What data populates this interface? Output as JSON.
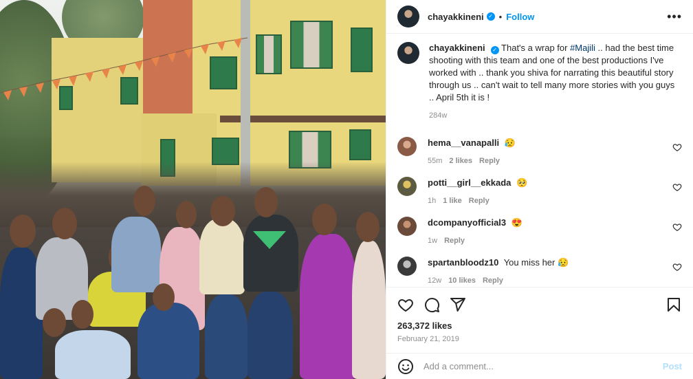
{
  "post": {
    "username": "chayakkineni",
    "follow_label": "Follow",
    "more_label": "•••",
    "verified_mark": "✓"
  },
  "caption": {
    "username": "chayakkineni",
    "text_before": "That's a wrap for ",
    "hashtag": "#Majili",
    "text_after": " .. had the best time shooting with this team and one of the best productions I've worked with .. thank you shiva for narrating this beautiful story through us .. can't wait to tell many more stories with you guys .. April 5th it is !",
    "age": "284w"
  },
  "comments": [
    {
      "username": "hema__vanapalli",
      "text": "😥",
      "age": "55m",
      "likes": "2 likes",
      "reply": "Reply",
      "avatar_color": "#8a5a44"
    },
    {
      "username": "potti__girl__ekkada",
      "text": "🥺",
      "age": "1h",
      "likes": "1 like",
      "reply": "Reply",
      "avatar_color": "#5c5a40"
    },
    {
      "username": "dcompanyofficial3",
      "text": "😍",
      "age": "1w",
      "likes": "",
      "reply": "Reply",
      "avatar_color": "#6b4a3a"
    },
    {
      "username": "spartanbloodz10",
      "text": "You miss her 😥",
      "age": "12w",
      "likes": "10 likes",
      "reply": "Reply",
      "avatar_color": "#3a3a3a"
    }
  ],
  "actions": {
    "likes": "263,372 likes",
    "date": "February 21, 2019"
  },
  "composer": {
    "placeholder": "Add a comment...",
    "post_label": "Post"
  },
  "colors": {
    "accent": "#0095f6",
    "link": "#00376b",
    "muted": "#8e8e8e",
    "post_disabled": "#b2dffc"
  },
  "icons": [
    "heart-icon",
    "comment-icon",
    "share-icon",
    "bookmark-icon",
    "emoji-icon",
    "more-icon",
    "verified-icon"
  ]
}
